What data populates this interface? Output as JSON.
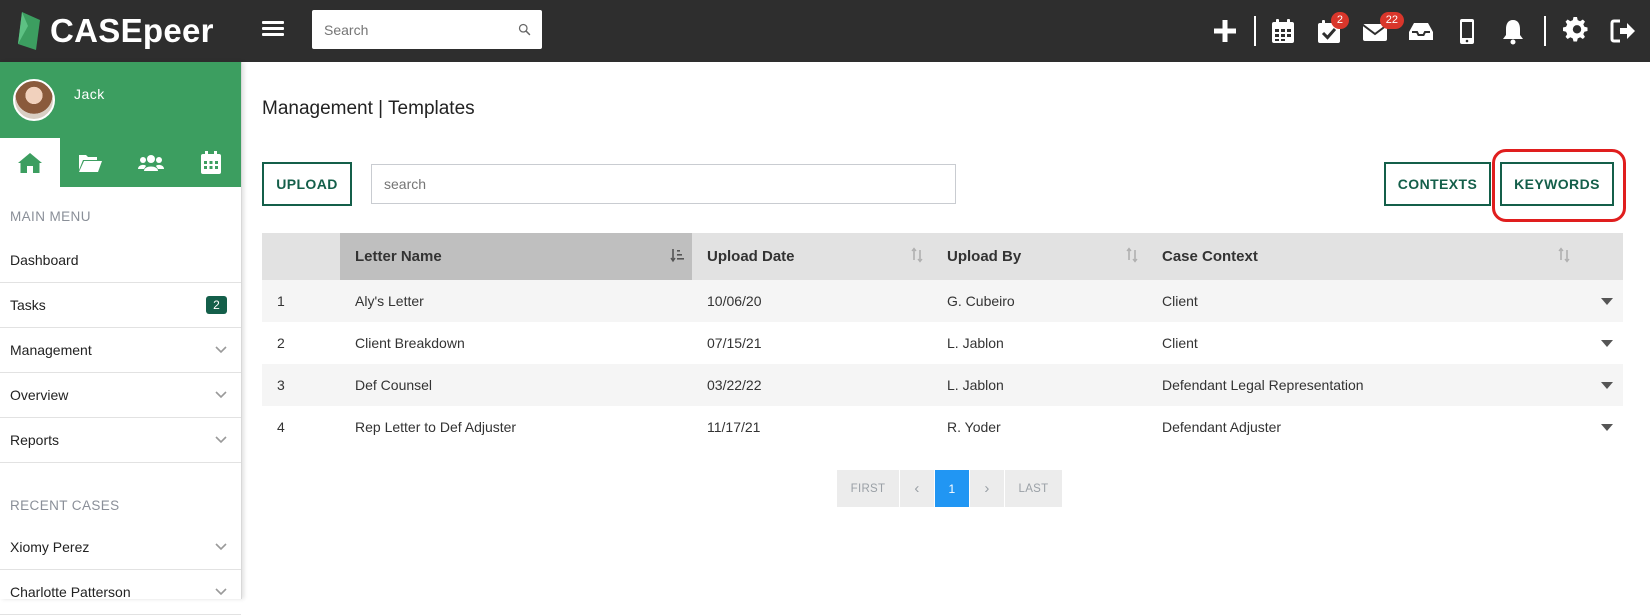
{
  "app": {
    "brand": "CASEpeer",
    "brand_color": "#3c9e60",
    "accent_dark": "#145f4a"
  },
  "topbar": {
    "search_placeholder": "Search",
    "icons": [
      {
        "name": "plus-icon"
      },
      {
        "name": "calendar-icon"
      },
      {
        "name": "tasks-check-icon",
        "badge": "2"
      },
      {
        "name": "mail-icon",
        "badge": "22"
      },
      {
        "name": "inbox-tray-icon"
      },
      {
        "name": "mobile-phone-icon"
      },
      {
        "name": "bell-icon"
      },
      {
        "name": "gear-icon"
      },
      {
        "name": "sign-out-icon"
      }
    ]
  },
  "sidebar": {
    "user_name": "Jack",
    "tabs": [
      "home-icon",
      "folder-open-icon",
      "users-icon",
      "calendar-icon"
    ],
    "main_menu_label": "MAIN MENU",
    "main_menu": [
      {
        "label": "Dashboard"
      },
      {
        "label": "Tasks",
        "badge": "2"
      },
      {
        "label": "Management",
        "expandable": true
      },
      {
        "label": "Overview",
        "expandable": true
      },
      {
        "label": "Reports",
        "expandable": true
      }
    ],
    "recent_label": "RECENT CASES",
    "recent_cases": [
      {
        "label": "Xiomy Perez"
      },
      {
        "label": "Charlotte Patterson"
      }
    ]
  },
  "main": {
    "title": "Management | Templates",
    "upload_label": "UPLOAD",
    "search_placeholder": "search",
    "contexts_label": "CONTEXTS",
    "keywords_label": "KEYWORDS",
    "table": {
      "headers": [
        "",
        "Letter Name",
        "Upload Date",
        "Upload By",
        "Case Context"
      ],
      "rows": [
        [
          "1",
          "Aly's Letter",
          "10/06/20",
          "G. Cubeiro",
          "Client"
        ],
        [
          "2",
          "Client Breakdown",
          "07/15/21",
          "L. Jablon",
          "Client"
        ],
        [
          "3",
          "Def Counsel",
          "03/22/22",
          "L. Jablon",
          "Defendant Legal Representation"
        ],
        [
          "4",
          "Rep Letter to Def Adjuster",
          "11/17/21",
          "R. Yoder",
          "Defendant Adjuster"
        ]
      ]
    },
    "pagination": {
      "first": "FIRST",
      "prev": "‹",
      "current": "1",
      "next": "›",
      "last": "LAST"
    }
  }
}
